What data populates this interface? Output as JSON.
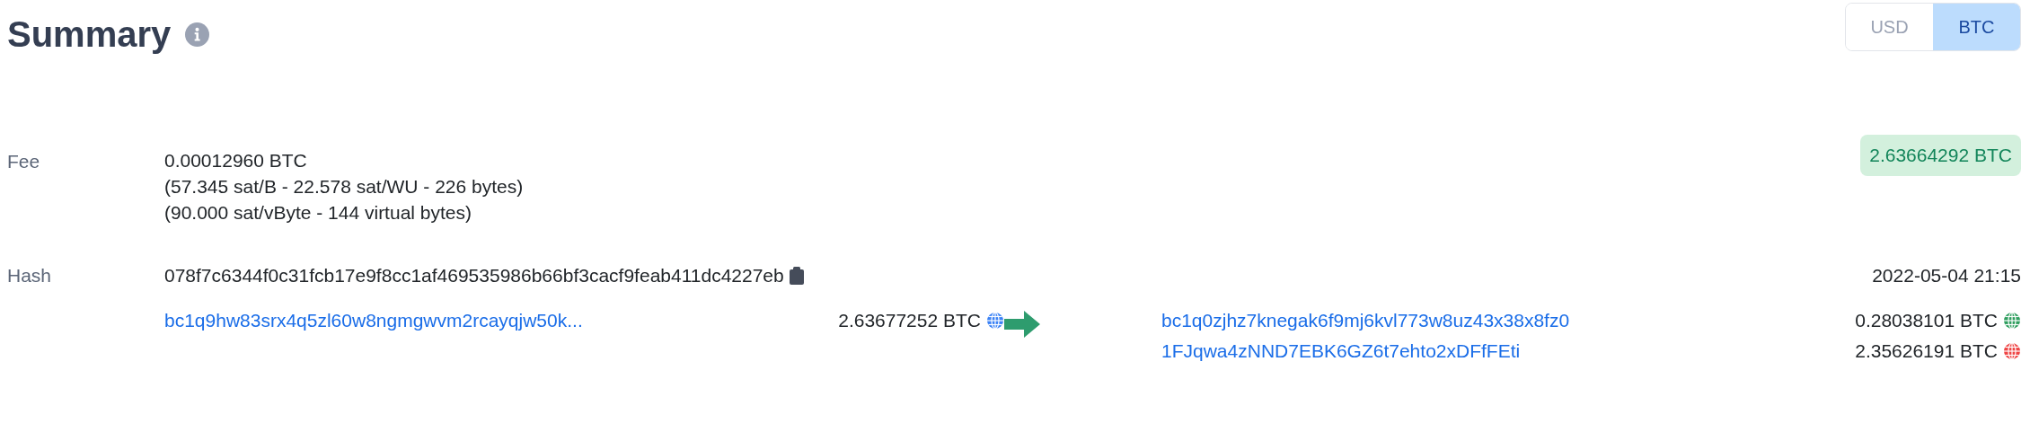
{
  "title": "Summary",
  "currency_toggle": [
    {
      "label": "USD",
      "selected": false
    },
    {
      "label": "BTC",
      "selected": true
    }
  ],
  "fee": {
    "label": "Fee",
    "lines": [
      "0.00012960 BTC",
      "(57.345 sat/B - 22.578 sat/WU - 226 bytes)",
      "(90.000 sat/vByte - 144 virtual bytes)"
    ],
    "total": "2.63664292 BTC"
  },
  "hash": {
    "label": "Hash",
    "value": "078f7c6344f0c31fcb17e9f8cc1af469535986b66bf3cacf9feab411dc4227eb",
    "time": "2022-05-04 21:15"
  },
  "inputs": [
    {
      "address": "bc1q9hw83srx4q5zl60w8ngmgwvm2rcayqjw50k...",
      "amount": "2.63677252 BTC",
      "color": "#3b82f6"
    }
  ],
  "outputs": [
    {
      "address": "bc1q0zjhz7knegak6f9mj6kvl773w8uz43x38x8fz0",
      "amount": "0.28038101 BTC",
      "color": "#2e9e5e"
    },
    {
      "address": "1FJqwa4zNND7EBK6GZ6t7ehto2xDFfFEti",
      "amount": "2.35626191 BTC",
      "color": "#ef4444"
    }
  ]
}
